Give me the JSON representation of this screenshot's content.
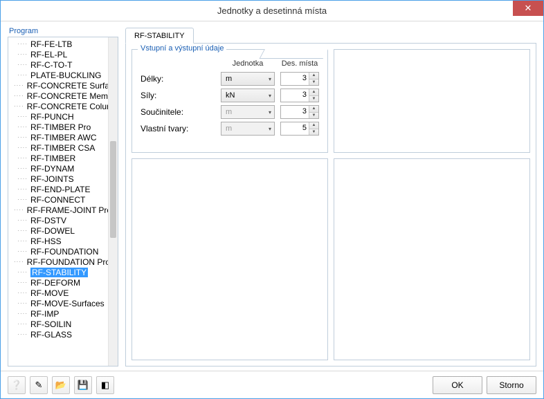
{
  "window": {
    "title": "Jednotky a desetinná místa"
  },
  "sidebar": {
    "label": "Program",
    "items": [
      "RF-FE-LTB",
      "RF-EL-PL",
      "RF-C-TO-T",
      "PLATE-BUCKLING",
      "RF-CONCRETE Surfaces",
      "RF-CONCRETE Members",
      "RF-CONCRETE Columns",
      "RF-PUNCH",
      "RF-TIMBER Pro",
      "RF-TIMBER AWC",
      "RF-TIMBER CSA",
      "RF-TIMBER",
      "RF-DYNAM",
      "RF-JOINTS",
      "RF-END-PLATE",
      "RF-CONNECT",
      "RF-FRAME-JOINT Pro",
      "RF-DSTV",
      "RF-DOWEL",
      "RF-HSS",
      "RF-FOUNDATION",
      "RF-FOUNDATION Pro",
      "RF-STABILITY",
      "RF-DEFORM",
      "RF-MOVE",
      "RF-MOVE-Surfaces",
      "RF-IMP",
      "RF-SOILIN",
      "RF-GLASS"
    ],
    "selected": "RF-STABILITY"
  },
  "tab": {
    "label": "RF-STABILITY"
  },
  "panel": {
    "title": "Vstupní a výstupní údaje",
    "headers": {
      "unit": "Jednotka",
      "decimals": "Des. místa"
    },
    "rows": [
      {
        "label": "Délky:",
        "unit": "m",
        "decimals": 3,
        "unit_enabled": true
      },
      {
        "label": "Síly:",
        "unit": "kN",
        "decimals": 3,
        "unit_enabled": true
      },
      {
        "label": "Součinitele:",
        "unit": "m",
        "decimals": 3,
        "unit_enabled": false
      },
      {
        "label": "Vlastní tvary:",
        "unit": "m",
        "decimals": 5,
        "unit_enabled": false
      }
    ]
  },
  "footer": {
    "ok": "OK",
    "cancel": "Storno"
  }
}
